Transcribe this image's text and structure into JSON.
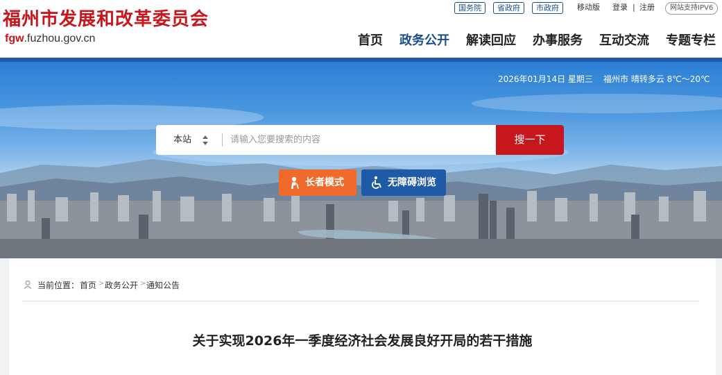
{
  "site": {
    "title": "福州市发展和改革委员会",
    "domain_prefix": "fgw",
    "domain_suffix": ".fuzhou.gov.cn"
  },
  "toplinks": {
    "gov_links": [
      "国务院",
      "省政府",
      "市政府"
    ],
    "mobile": "移动版",
    "login": "登录",
    "divider": "|",
    "register": "注册",
    "ipv6": "网站支持IPV6"
  },
  "nav": {
    "items": [
      "首页",
      "政务公开",
      "解读回应",
      "办事服务",
      "互动交流",
      "专题专栏"
    ],
    "active_index": 1
  },
  "banner": {
    "date": "2026年01月14日 星期三",
    "weather": "福州市 晴转多云 8℃～20℃"
  },
  "search": {
    "scope": "本站",
    "placeholder": "请输入您要搜索的内容",
    "button": "搜一下"
  },
  "modes": {
    "elder": "长者模式",
    "accessible": "无障碍浏览"
  },
  "breadcrumb": {
    "prefix": "当前位置：",
    "items": [
      "首页",
      "政务公开",
      "通知公告"
    ],
    "separator": ">"
  },
  "article": {
    "title": "关于实现2026年一季度经济社会发展良好开局的若干措施"
  },
  "colors": {
    "brand_red": "#c8161d",
    "brand_blue": "#1f5aa6",
    "elder_orange": "#ef6a2b"
  }
}
